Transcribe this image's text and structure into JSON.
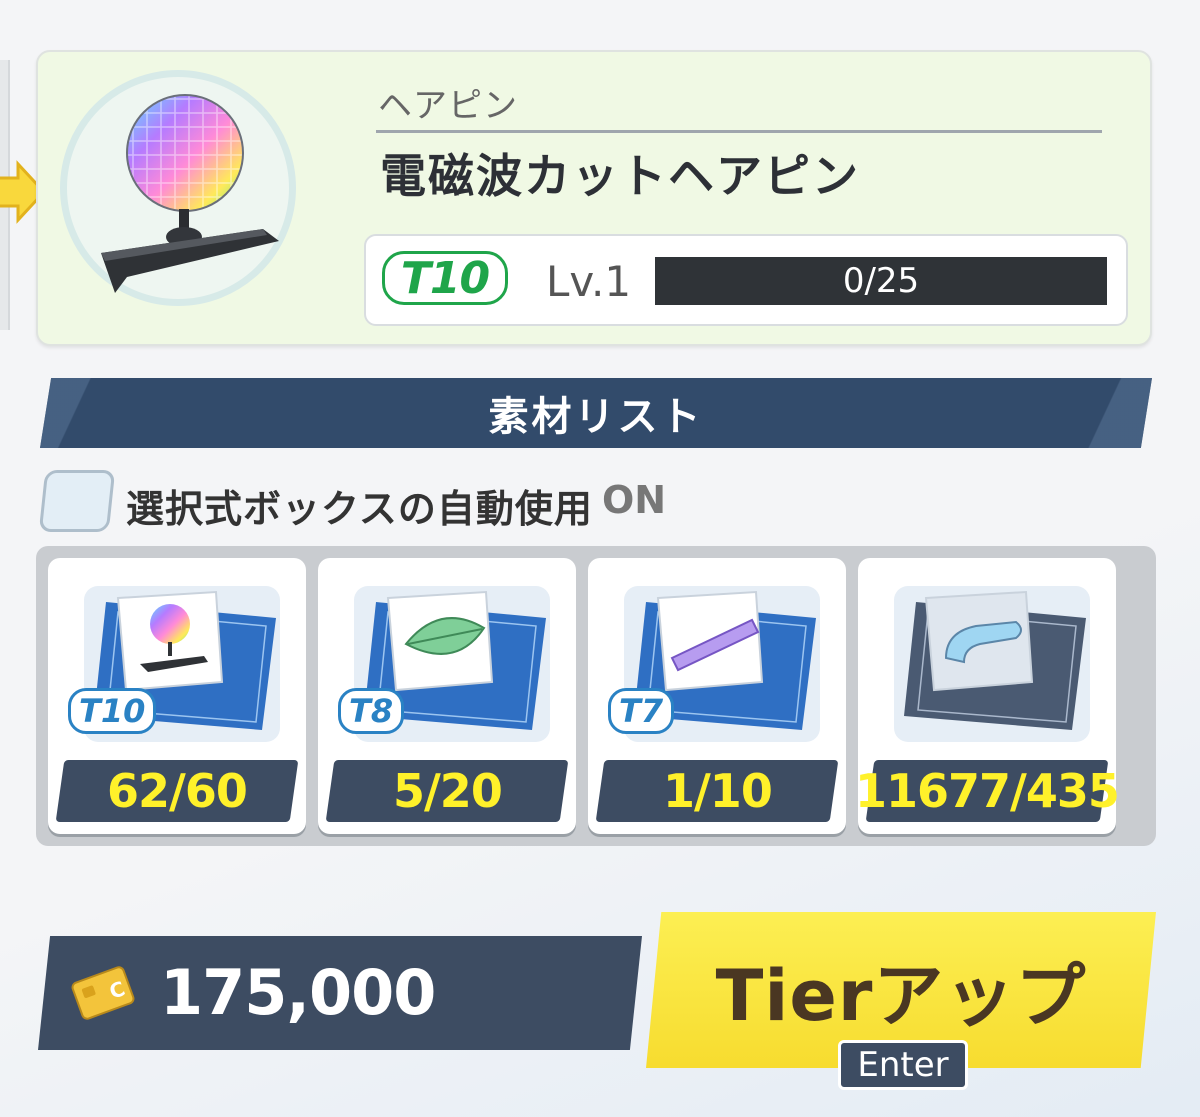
{
  "item": {
    "category": "ヘアピン",
    "name": "電磁波カットヘアピン",
    "tier": "T10",
    "level": "Lv.1",
    "exp": "0/25"
  },
  "materials_header": "素材リスト",
  "auto_use": {
    "label": "選択式ボックスの自動使用",
    "state": "ON"
  },
  "materials": [
    {
      "tier": "T10",
      "count": "62/60",
      "icon": "disco-hairpin-blueprint"
    },
    {
      "tier": "T8",
      "count": "5/20",
      "icon": "leaf-hairpin-blueprint"
    },
    {
      "tier": "T7",
      "count": "1/10",
      "icon": "jump-hairpin-blueprint"
    },
    {
      "tier": "",
      "count": "11677/435",
      "icon": "generic-hairpin-blueprint"
    }
  ],
  "cost": "175,000",
  "tier_up_button": "Tierアップ",
  "enter_key": "Enter",
  "colors": {
    "tier_green": "#1fa54a",
    "tier_blue": "#2a82c4",
    "count_yellow": "#fff12a",
    "navy": "#3d4c62",
    "button_yellow": "#f7dc2f"
  }
}
